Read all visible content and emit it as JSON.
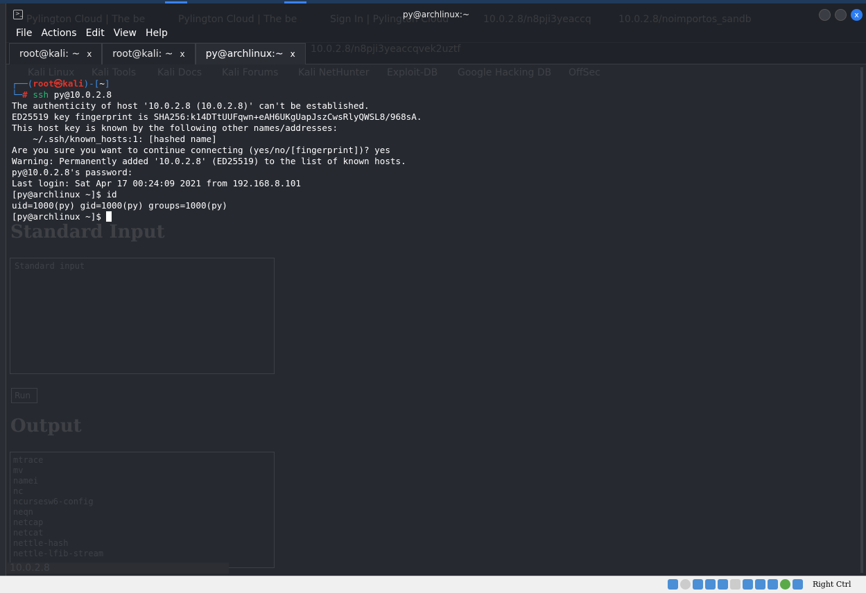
{
  "window": {
    "title": "py@archlinux:~",
    "close_label": "x"
  },
  "menu": [
    "File",
    "Actions",
    "Edit",
    "View",
    "Help"
  ],
  "tabs": [
    {
      "label": "root@kali: ~",
      "close": "x",
      "active": false
    },
    {
      "label": "root@kali: ~",
      "close": "x",
      "active": false
    },
    {
      "label": "py@archlinux:~",
      "close": "x",
      "active": true
    }
  ],
  "terminal": {
    "prompt_user": "root",
    "prompt_symbol": "㉿",
    "prompt_host": "kali",
    "prompt_dir": "~",
    "command_name": "ssh",
    "command_args": " py@10.0.2.8",
    "lines": [
      "The authenticity of host '10.0.2.8 (10.0.2.8)' can't be established.",
      "ED25519 key fingerprint is SHA256:k14DTtUUFqwn+eAH6UKgUapJszCwsRlyQWSL8/968sA.",
      "This host key is known by the following other names/addresses:",
      "    ~/.ssh/known_hosts:1: [hashed name]",
      "Are you sure you want to continue connecting (yes/no/[fingerprint])? yes",
      "Warning: Permanently added '10.0.2.8' (ED25519) to the list of known hosts.",
      "py@10.0.2.8's password: ",
      "Last login: Sat Apr 17 00:24:09 2021 from 192.168.8.101",
      "[py@archlinux ~]$ id",
      "uid=1000(py) gid=1000(py) groups=1000(py)"
    ],
    "current_prompt": "[py@archlinux ~]$ "
  },
  "background_browser": {
    "tabs": [
      "Pylington Cloud | The be",
      "Pylington Cloud | The be",
      "Sign In | Pylington Cloud",
      "10.0.2.8/n8pji3yeaccq",
      "10.0.2.8/noimportos_sandb"
    ],
    "url": "10.0.2.8/n8pji3yeaccqvek2uztf",
    "bookmarks": [
      "Kali Linux",
      "Kali Tools",
      "Kali Docs",
      "Kali Forums",
      "Kali NetHunter",
      "Exploit-DB",
      "Google Hacking DB",
      "OffSec"
    ],
    "standard_input_heading": "Standard Input",
    "standard_input_placeholder": "Standard input",
    "run_button": "Run",
    "output_heading": "Output",
    "output_lines": [
      "mtrace",
      "mv",
      "namei",
      "nc",
      "ncursesw6-config",
      "neqn",
      "netcap",
      "netcat",
      "nettle-hash",
      "nettle-lfib-stream"
    ],
    "status_url": "10.0.2.8"
  },
  "host_status": {
    "host_key": "Right Ctrl"
  }
}
